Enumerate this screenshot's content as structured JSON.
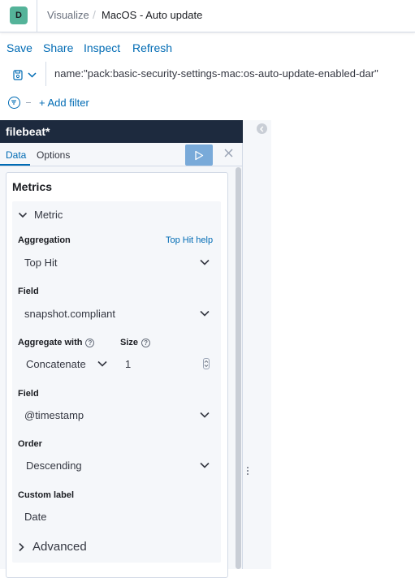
{
  "header": {
    "avatar_letter": "D",
    "breadcrumbs": [
      "Visualize",
      "MacOS - Auto update"
    ],
    "separator": "/"
  },
  "topnav": {
    "save": "Save",
    "share": "Share",
    "inspect": "Inspect",
    "refresh": "Refresh"
  },
  "query": {
    "text": "name:\"pack:basic-security-settings-mac:os-auto-update-enabled-dar\""
  },
  "filter": {
    "add_filter": "+ Add filter"
  },
  "editor": {
    "index_pattern": "filebeat*",
    "tabs": {
      "data": "Data",
      "options": "Options"
    },
    "metrics_title": "Metrics",
    "metric_label": "Metric",
    "aggregation": {
      "label": "Aggregation",
      "help_link": "Top Hit help",
      "value": "Top Hit"
    },
    "field1": {
      "label": "Field",
      "value": "snapshot.compliant"
    },
    "aggregate_with": {
      "label": "Aggregate with",
      "value": "Concatenate"
    },
    "size": {
      "label": "Size",
      "value": "1"
    },
    "field2": {
      "label": "Field",
      "value": "@timestamp"
    },
    "order": {
      "label": "Order",
      "value": "Descending"
    },
    "custom_label": {
      "label": "Custom label",
      "value": "Date"
    },
    "advanced": "Advanced"
  },
  "colors": {
    "accent": "#006bb4",
    "avatar": "#54b399",
    "sidebar_header": "#1d2a3e",
    "apply_button": "#79aad9"
  }
}
